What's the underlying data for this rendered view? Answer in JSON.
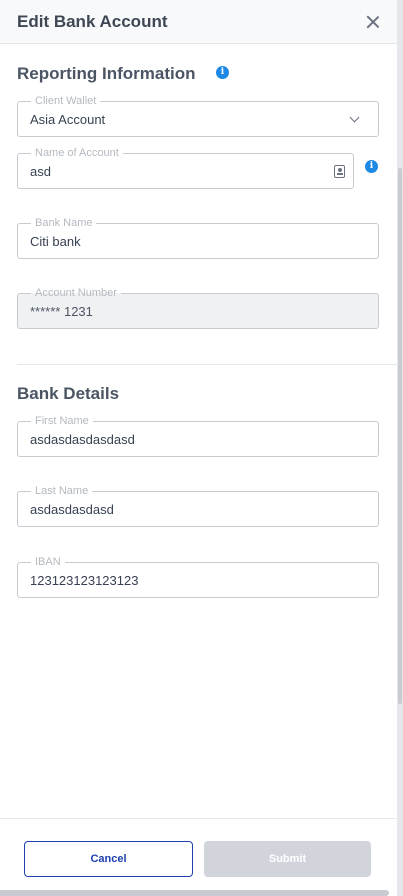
{
  "header": {
    "title": "Edit Bank Account"
  },
  "reporting": {
    "title": "Reporting Information",
    "client_wallet": {
      "label": "Client Wallet",
      "value": "Asia Account"
    },
    "name_of_account": {
      "label": "Name of Account",
      "value": "asd"
    },
    "bank_name": {
      "label": "Bank Name",
      "value": "Citi bank"
    },
    "account_number": {
      "label": "Account Number",
      "value": "****** 1231"
    }
  },
  "bank_details": {
    "title": "Bank Details",
    "first_name": {
      "label": "First Name",
      "value": "asdasdasdasdasd"
    },
    "last_name": {
      "label": "Last Name",
      "value": "asdasdasdasd"
    },
    "iban": {
      "label": "IBAN",
      "value": "123123123123123"
    }
  },
  "footer": {
    "cancel_label": "Cancel",
    "submit_label": "Submit"
  },
  "colors": {
    "accent": "#1e40af",
    "info": "#1e88e5",
    "submit_disabled": "#d1d5db"
  },
  "icons": [
    "close-icon",
    "info-icon",
    "chevron-down-icon",
    "contact-card-icon"
  ]
}
